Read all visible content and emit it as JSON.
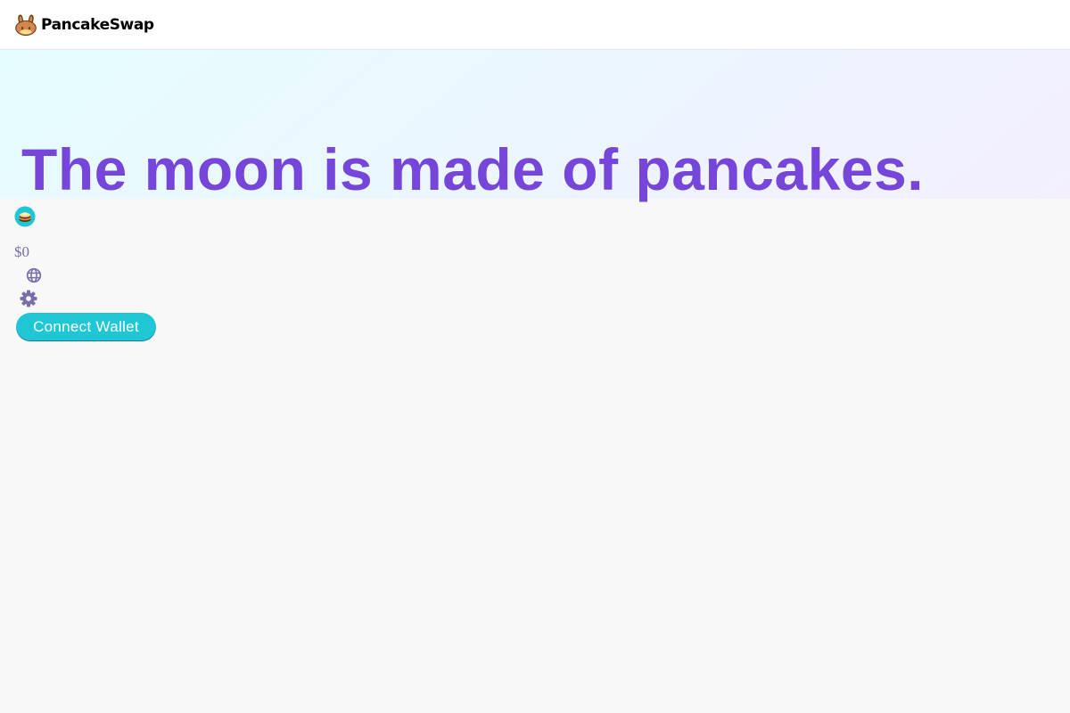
{
  "header": {
    "brand_name": "PancakeSwap",
    "logo_icon": "bunny-icon"
  },
  "hero": {
    "title": "The moon is made of pancakes."
  },
  "sidebar": {
    "cake_icon": "cake-token-icon",
    "cake_price": "$0",
    "language_icon": "globe-icon",
    "settings_icon": "gear-icon",
    "connect_label": "Connect Wallet"
  },
  "colors": {
    "primary": "#1FC7D4",
    "secondary": "#7645D9",
    "text_subtle": "#7A6EAA",
    "background": "#F8F8F8"
  }
}
